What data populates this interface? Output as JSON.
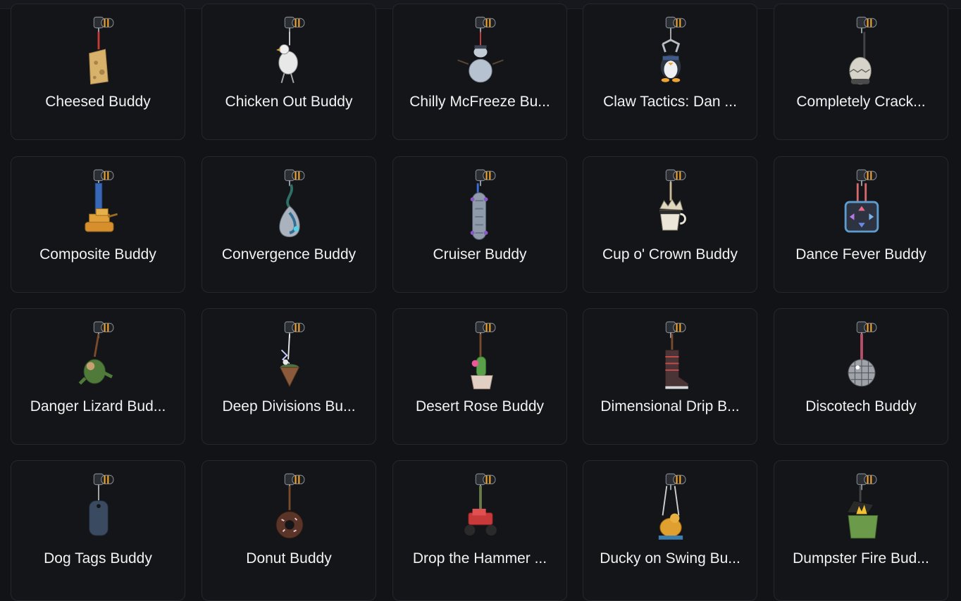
{
  "colors": {
    "background": "#111317",
    "card_bg": "#131519",
    "card_border": "#24272e",
    "text": "#f2f2f2",
    "clip_accent": "#f0a531"
  },
  "buddies": [
    {
      "name": "Cheesed Buddy",
      "icon": "cheese-charm-icon"
    },
    {
      "name": "Chicken Out Buddy",
      "icon": "chicken-charm-icon"
    },
    {
      "name": "Chilly McFreeze Bu...",
      "icon": "snowman-charm-icon"
    },
    {
      "name": "Claw Tactics: Dan ...",
      "icon": "penguin-claw-charm-icon"
    },
    {
      "name": "Completely Crack...",
      "icon": "egg-charm-icon"
    },
    {
      "name": "Composite Buddy",
      "icon": "tank-charm-icon"
    },
    {
      "name": "Convergence Buddy",
      "icon": "teardrop-charm-icon"
    },
    {
      "name": "Cruiser Buddy",
      "icon": "skateboard-charm-icon"
    },
    {
      "name": "Cup o' Crown Buddy",
      "icon": "crown-cup-charm-icon"
    },
    {
      "name": "Dance Fever Buddy",
      "icon": "dance-pad-charm-icon"
    },
    {
      "name": "Danger Lizard Bud...",
      "icon": "lizard-charm-icon"
    },
    {
      "name": "Deep Divisions Bu...",
      "icon": "floating-island-charm-icon"
    },
    {
      "name": "Desert Rose Buddy",
      "icon": "cactus-charm-icon"
    },
    {
      "name": "Dimensional Drip B...",
      "icon": "boot-charm-icon"
    },
    {
      "name": "Discotech Buddy",
      "icon": "disco-ball-charm-icon"
    },
    {
      "name": "Dog Tags Buddy",
      "icon": "dog-tag-charm-icon"
    },
    {
      "name": "Donut Buddy",
      "icon": "donut-charm-icon"
    },
    {
      "name": "Drop the Hammer ...",
      "icon": "monster-truck-charm-icon"
    },
    {
      "name": "Ducky on Swing Bu...",
      "icon": "duck-swing-charm-icon"
    },
    {
      "name": "Dumpster Fire Bud...",
      "icon": "dumpster-charm-icon"
    }
  ]
}
